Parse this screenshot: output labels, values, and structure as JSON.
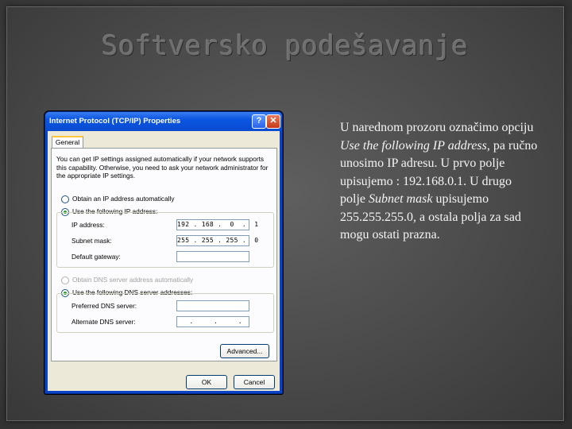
{
  "slide": {
    "title": "Softversko podešavanje",
    "text_parts": [
      {
        "text": "U narednom prozoru označimo opciju ",
        "italic": false
      },
      {
        "text": "Use the following IP address",
        "italic": true
      },
      {
        "text": ", pa ručno unosimo IP adresu. U prvo polje upisujemo : 192.168.0.1. U drugo polje ",
        "italic": false
      },
      {
        "text": "Subnet mask",
        "italic": true
      },
      {
        "text": " upisujemo 255.255.255.0, a ostala polja za sad mogu ostati prazna.",
        "italic": false
      }
    ]
  },
  "dialog": {
    "title": "Internet Protocol (TCP/IP) Properties",
    "help_label": "?",
    "close_label": "✕",
    "tab_label": "General",
    "description": "You can get IP settings assigned automatically if your network supports this capability. Otherwise, you need to ask your network administrator for the appropriate IP settings.",
    "radio_auto_ip": "Obtain an IP address automatically",
    "radio_manual_ip": "Use the following IP address:",
    "ip_label": "IP address:",
    "ip_value": "192 . 168 .  0  .  1",
    "subnet_label": "Subnet mask:",
    "subnet_value": "255 . 255 . 255 .  0",
    "gateway_label": "Default gateway:",
    "gateway_value": "",
    "radio_auto_dns": "Obtain DNS server address automatically",
    "radio_manual_dns": "Use the following DNS server addresses:",
    "pref_dns_label": "Preferred DNS server:",
    "pref_dns_value": "",
    "alt_dns_label": "Alternate DNS server:",
    "alt_dns_value": "   .     .     .   ",
    "advanced_label": "Advanced...",
    "ok_label": "OK",
    "cancel_label": "Cancel"
  }
}
